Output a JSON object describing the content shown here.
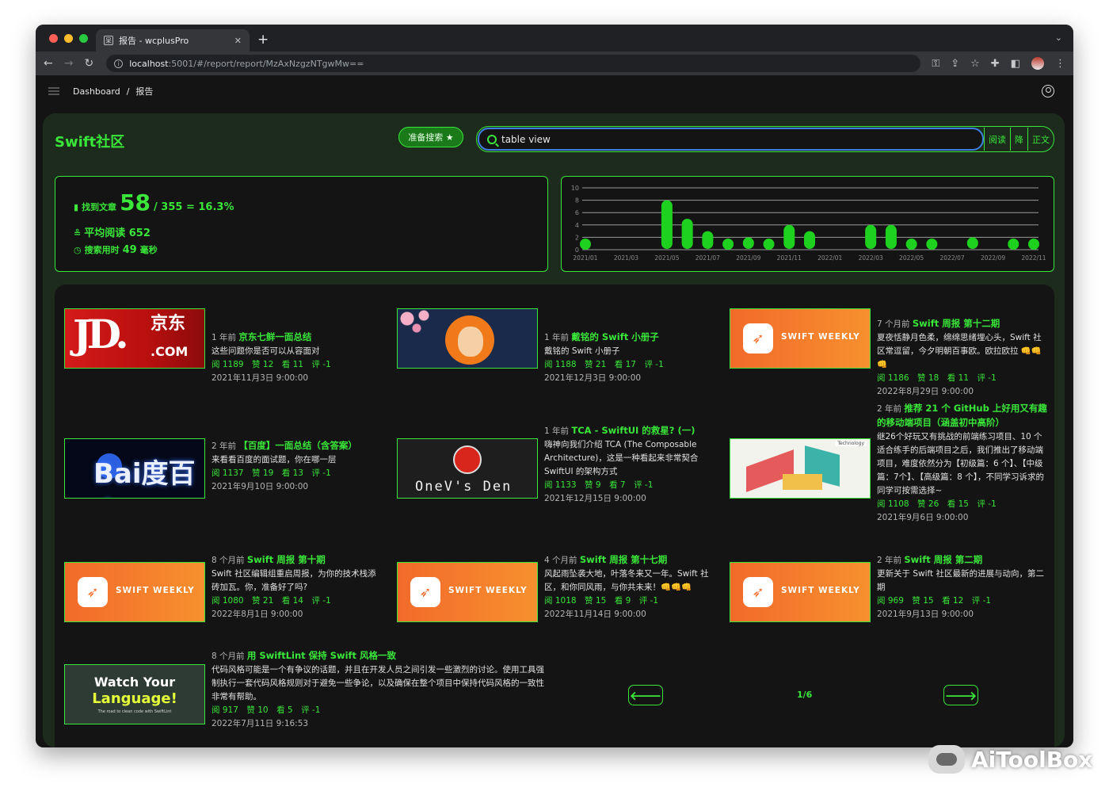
{
  "browser": {
    "tab_title": "报告 - wcplusPro",
    "tab_favicon": "呆",
    "url_host": "localhost",
    "url_rest": ":5001/#/report/report/MzAxNzgzNTgwMw=="
  },
  "breadcrumb": {
    "home": "Dashboard",
    "sep": "/",
    "current": "报告"
  },
  "panel": {
    "title": "Swift社区",
    "prepare_button": "准备搜索 ★",
    "search_value": "table view",
    "options": [
      "阅读",
      "降",
      "正文"
    ]
  },
  "stats": {
    "found_label": "找到文章",
    "found_count": "58",
    "ratio": "/ 355 = 16.3%",
    "avg_read": "平均阅读 652",
    "time_label": "搜索用时",
    "time_value": "49",
    "time_unit": "毫秒"
  },
  "chart_data": {
    "type": "scatter",
    "title": "",
    "xlabel": "",
    "ylabel": "",
    "yticks": [
      0,
      2,
      4,
      6,
      8,
      10
    ],
    "ylim": [
      0,
      10
    ],
    "xticks": [
      "2021/01",
      "2021/03",
      "2021/05",
      "2021/07",
      "2021/09",
      "2021/11",
      "2022/01",
      "2022/03",
      "2022/05",
      "2022/07",
      "2022/09",
      "2022/11"
    ],
    "month_labels": [
      "2021/01",
      "2021/02",
      "2021/03",
      "2021/04",
      "2021/05",
      "2021/06",
      "2021/07",
      "2021/08",
      "2021/09",
      "2021/10",
      "2021/11",
      "2021/12",
      "2022/01",
      "2022/02",
      "2022/03",
      "2022/04",
      "2022/05",
      "2022/06",
      "2022/07",
      "2022/08",
      "2022/09",
      "2022/10",
      "2022/11"
    ],
    "values": [
      1,
      0,
      0,
      0,
      8,
      5,
      3,
      1,
      2,
      1,
      4,
      3,
      0,
      0,
      4,
      4,
      1,
      1,
      0,
      2,
      0,
      1,
      1
    ],
    "color": "#1fd11f"
  },
  "articles": [
    {
      "ago": "1 年前",
      "title": "京东七鲜一面总结",
      "desc": "这些问题你是否可以从容面对",
      "metrics": "阅 1189　赞 12　看 11　评 -1",
      "date": "2021年11月3日 9:00:00",
      "thumb_icon": "jd-logo"
    },
    {
      "ago": "1 年前",
      "title": "戴铭的 Swift 小册子",
      "desc": "戴铭的 Swift 小册子",
      "metrics": "阅 1188　赞 21　看 17　评 -1",
      "date": "2021年12月3日 9:00:00",
      "thumb_icon": "anime-girl"
    },
    {
      "ago": "7 个月前",
      "title": "Swift 周报 第十二期",
      "desc": "夏夜恬静月色柔，绵绵思绪埋心头，Swift 社区常逗留，今夕明朝百事欧。欧拉欧拉 👊👊👊",
      "metrics": "阅 1186　赞 18　看 11　评 -1",
      "date": "2022年8月29日 9:00:00",
      "thumb_icon": "swift-logo"
    },
    {
      "ago": "2 年前",
      "title": "【百度】一面总结（含答案）",
      "desc": "来看看百度的面试题，你在哪一层",
      "metrics": "阅 1137　赞 19　看 13　评 -1",
      "date": "2021年9月10日 9:00:00",
      "thumb_icon": "baidu-logo"
    },
    {
      "ago": "1 年前",
      "title": "TCA - SwiftUI 的救星? (一)",
      "desc": "嗨神向我们介绍 TCA (The Composable Architecture)，这是一种看起来非常契合 SwiftUI 的架构方式",
      "metrics": "阅 1133　赞 9　看 7　评 -1",
      "date": "2021年12月15日 9:00:00",
      "thumb_icon": "onev-den"
    },
    {
      "ago": "2 年前",
      "title": "推荐 21 个 GitHub 上好用又有趣的移动端项目（涵盖初中高阶）",
      "desc": "继26个好玩又有挑战的前端练习项目、10 个适合练手的后端项目之后，我们推出了移动端项目，难度依然分为【初级篇：6 个】、【中级篇：7个】、【高级篇：8 个】，不同学习诉求的同学可按需选择~",
      "metrics": "阅 1108　赞 26　看 15　评 -1",
      "date": "2021年9月6日 9:00:00",
      "thumb_icon": "github-illustration"
    },
    {
      "ago": "8 个月前",
      "title": "Swift 周报 第十期",
      "desc": "Swift 社区编辑组重启周报，为你的技术栈添砖加瓦。你，准备好了吗?",
      "metrics": "阅 1080　赞 21　看 14　评 -1",
      "date": "2022年8月1日 9:00:00",
      "thumb_icon": "swift-logo"
    },
    {
      "ago": "4 个月前",
      "title": "Swift 周报 第十七期",
      "desc": "风起雨坠袭大地，叶落冬来又一年。Swift 社区，和你同风雨，与你共未来！👊👊👊",
      "metrics": "阅 1018　赞 15　看 9　评 -1",
      "date": "2022年11月14日 9:00:00",
      "thumb_icon": "swift-logo"
    },
    {
      "ago": "2 年前",
      "title": "Swift 周报 第二期",
      "desc": "更新关于 Swift 社区最新的进展与动向，第二期",
      "metrics": "阅 969　赞 15　看 12　评 -1",
      "date": "2021年9月13日 9:00:00",
      "thumb_icon": "swift-logo"
    },
    {
      "ago": "8 个月前",
      "title": "用 SwiftLint 保持 Swift 风格一致",
      "desc": "代码风格可能是一个有争议的话题，并且在开发人员之间引发一些激烈的讨论。使用工具强制执行一套代码风格规则对于避免一些争论，以及确保在整个项目中保持代码风格的一致性非常有帮助。",
      "metrics": "阅 917　赞 10　看 5　评 -1",
      "date": "2022年7月11日 9:16:53",
      "thumb_icon": "watch-your-language"
    }
  ],
  "thumbs": {
    "jd_logo": "JD.",
    "jd_cn": "京东",
    "jd_com": ".COM",
    "swift_weekly": "SWIFT WEEKLY",
    "baidu": "Bai度百度",
    "onev": "OneV's Den",
    "github_tag": "Technology",
    "watch_1": "Watch Your",
    "watch_2": "Language!",
    "watch_3": "The road to clean code with SwiftLint"
  },
  "pager": {
    "prev": "🡐",
    "page": "1/6",
    "next": "🡒"
  },
  "watermark": "AiToolBox",
  "colors": {
    "accent": "#39e639",
    "panel_bg": "#1d2b1d",
    "app_bg": "#141414"
  }
}
